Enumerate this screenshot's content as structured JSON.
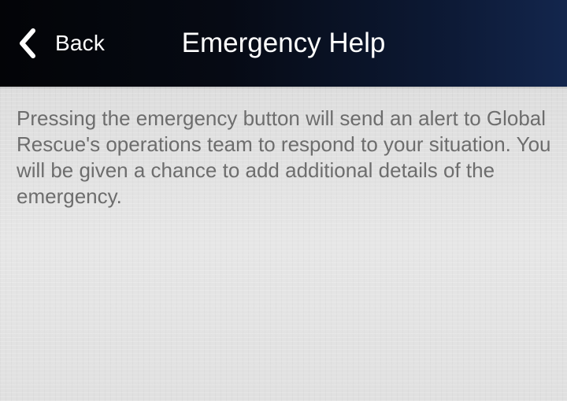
{
  "header": {
    "back_label": "Back",
    "title": "Emergency Help"
  },
  "content": {
    "description": "Pressing the emergency button will send an alert to Global Rescue's operations team to respond to your situation. You will be given a chance to add additional details of the emergency."
  },
  "icons": {
    "back": "chevron-left-icon"
  },
  "colors": {
    "header_background": "#050812",
    "header_text": "#ffffff",
    "body_text": "#6d6d6d",
    "content_background": "#e3e3e3"
  }
}
